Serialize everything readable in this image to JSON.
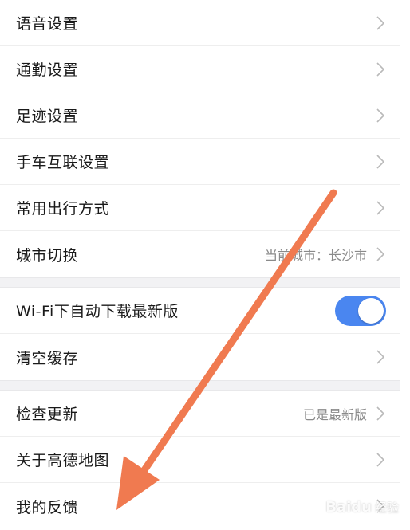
{
  "settings": {
    "group1": [
      {
        "label": "语音设置"
      },
      {
        "label": "通勤设置"
      },
      {
        "label": "足迹设置"
      },
      {
        "label": "手车互联设置"
      },
      {
        "label": "常用出行方式"
      },
      {
        "label": "城市切换",
        "value": "当前城市：长沙市"
      }
    ],
    "group2": [
      {
        "label": "Wi-Fi下自动下载最新版",
        "toggle_on": true
      },
      {
        "label": "清空缓存"
      }
    ],
    "group3": [
      {
        "label": "检查更新",
        "value": "已是最新版"
      },
      {
        "label": "关于高德地图"
      },
      {
        "label": "我的反馈"
      }
    ]
  },
  "colors": {
    "toggle_on": "#4a86f0",
    "annotation_arrow": "#f07a50"
  },
  "icons": {
    "row_chevron": "chevron-right-icon",
    "annotation": "orange-arrow-pointing-to-feedback"
  },
  "watermark": {
    "brand": "Baidu",
    "sub": "经验"
  }
}
